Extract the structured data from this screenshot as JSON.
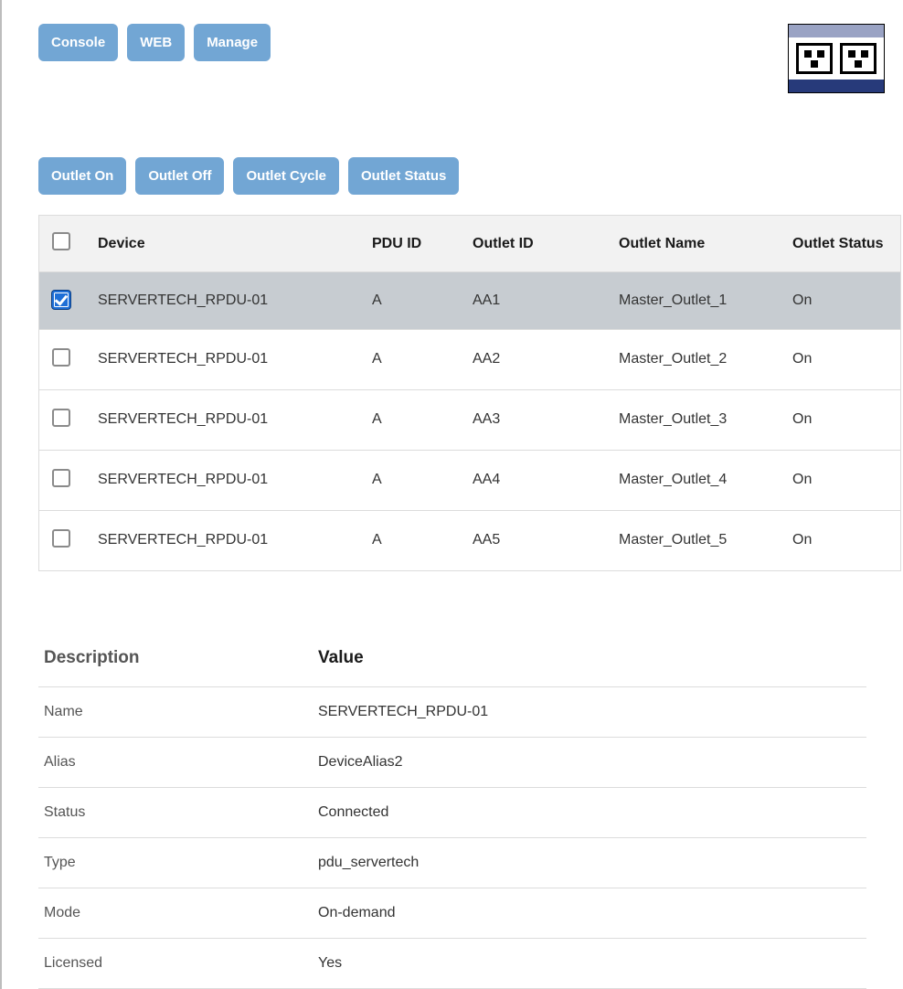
{
  "top_buttons": {
    "console": "Console",
    "web": "WEB",
    "manage": "Manage"
  },
  "actions": {
    "on": "Outlet On",
    "off": "Outlet Off",
    "cycle": "Outlet Cycle",
    "status": "Outlet Status"
  },
  "outlets": {
    "headers": {
      "device": "Device",
      "pdu_id": "PDU ID",
      "outlet_id": "Outlet ID",
      "outlet_name": "Outlet Name",
      "outlet_status": "Outlet Status"
    },
    "rows": [
      {
        "checked": true,
        "device": "SERVERTECH_RPDU-01",
        "pdu_id": "A",
        "outlet_id": "AA1",
        "outlet_name": "Master_Outlet_1",
        "status": "On"
      },
      {
        "checked": false,
        "device": "SERVERTECH_RPDU-01",
        "pdu_id": "A",
        "outlet_id": "AA2",
        "outlet_name": "Master_Outlet_2",
        "status": "On"
      },
      {
        "checked": false,
        "device": "SERVERTECH_RPDU-01",
        "pdu_id": "A",
        "outlet_id": "AA3",
        "outlet_name": "Master_Outlet_3",
        "status": "On"
      },
      {
        "checked": false,
        "device": "SERVERTECH_RPDU-01",
        "pdu_id": "A",
        "outlet_id": "AA4",
        "outlet_name": "Master_Outlet_4",
        "status": "On"
      },
      {
        "checked": false,
        "device": "SERVERTECH_RPDU-01",
        "pdu_id": "A",
        "outlet_id": "AA5",
        "outlet_name": "Master_Outlet_5",
        "status": "On"
      }
    ]
  },
  "details": {
    "headers": {
      "key": "Description",
      "value": "Value"
    },
    "rows": [
      {
        "key": "Name",
        "value": "SERVERTECH_RPDU-01"
      },
      {
        "key": "Alias",
        "value": "DeviceAlias2"
      },
      {
        "key": "Status",
        "value": "Connected"
      },
      {
        "key": "Type",
        "value": "pdu_servertech"
      },
      {
        "key": "Mode",
        "value": "On-demand"
      },
      {
        "key": "Licensed",
        "value": "Yes"
      }
    ]
  }
}
